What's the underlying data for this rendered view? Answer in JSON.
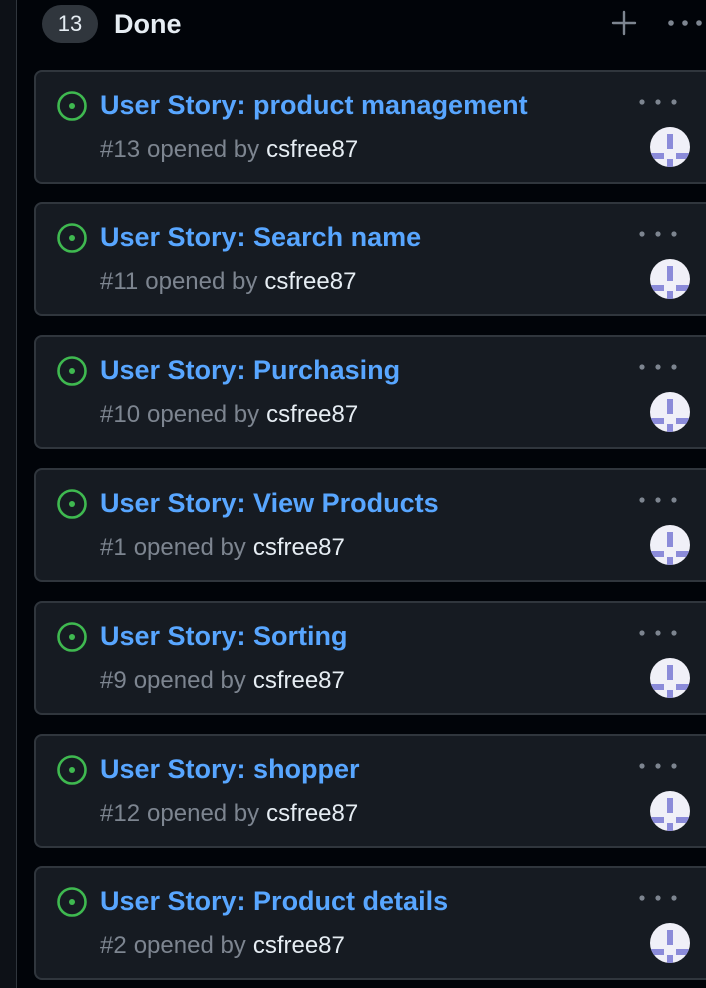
{
  "column": {
    "count": "13",
    "title": "Done",
    "add_icon": "plus-icon",
    "menu_icon": "kebab-horizontal-icon"
  },
  "card_icons": {
    "status": "issue-opened-icon",
    "menu": "kebab-horizontal-icon",
    "avatar": "identicon-avatar"
  },
  "cards": [
    {
      "title": "User Story: product management",
      "number": "#13",
      "opened_text": "opened by",
      "author": "csfree87"
    },
    {
      "title": "User Story: Search name",
      "number": "#11",
      "opened_text": "opened by",
      "author": "csfree87"
    },
    {
      "title": "User Story: Purchasing",
      "number": "#10",
      "opened_text": "opened by",
      "author": "csfree87"
    },
    {
      "title": "User Story: View Products",
      "number": "#1",
      "opened_text": "opened by",
      "author": "csfree87"
    },
    {
      "title": "User Story: Sorting",
      "number": "#9",
      "opened_text": "opened by",
      "author": "csfree87"
    },
    {
      "title": "User Story: shopper",
      "number": "#12",
      "opened_text": "opened by",
      "author": "csfree87"
    },
    {
      "title": "User Story: Product details",
      "number": "#2",
      "opened_text": "opened by",
      "author": "csfree87"
    }
  ],
  "colors": {
    "open_status": "#3fb950",
    "link": "#58a6ff",
    "avatar_accent": "#8b8bd9"
  }
}
